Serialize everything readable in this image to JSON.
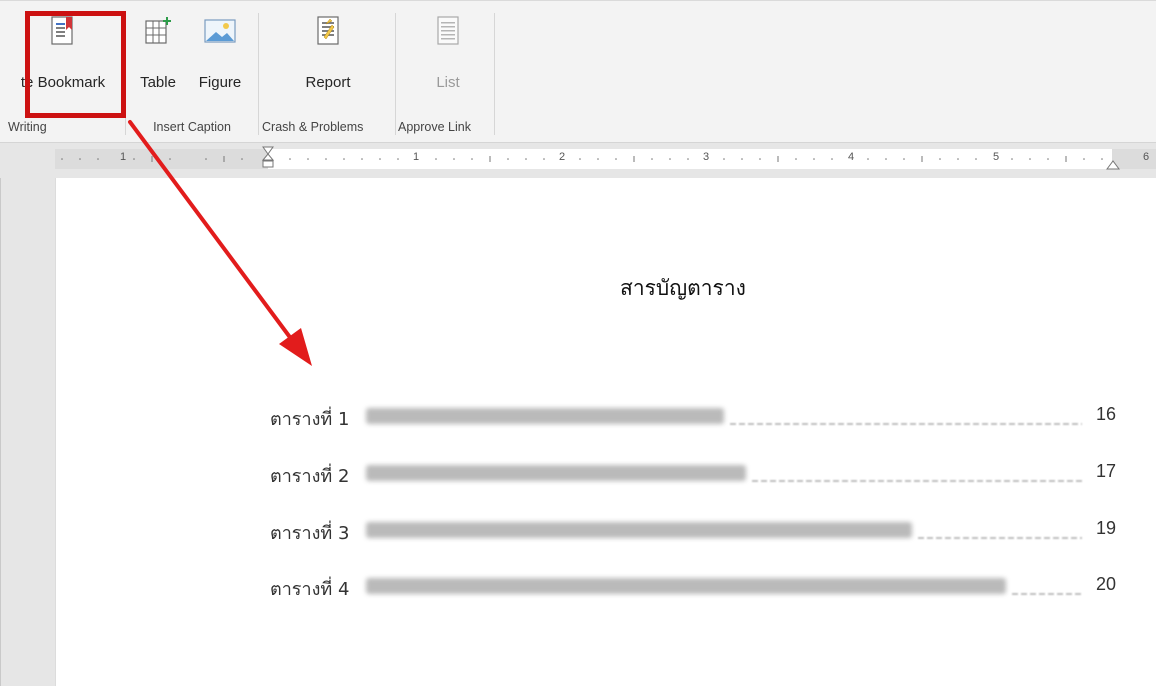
{
  "ribbon": {
    "groups": [
      {
        "label": "Writing",
        "buttons": [
          {
            "label": "te Bookmark",
            "icon": "bookmark-icon"
          }
        ]
      },
      {
        "label": "Insert Caption",
        "buttons": [
          {
            "label": "Table",
            "icon": "table-caption-icon"
          },
          {
            "label": "Figure",
            "icon": "figure-caption-icon"
          }
        ]
      },
      {
        "label": "Crash & Problems",
        "buttons": [
          {
            "label": "Report",
            "icon": "report-icon"
          }
        ]
      },
      {
        "label": "Approve Link",
        "buttons": [
          {
            "label": "List",
            "icon": "list-icon",
            "disabled": true
          }
        ]
      }
    ]
  },
  "ruler": {
    "ticks": [
      "1",
      "1",
      "2",
      "3",
      "4",
      "5",
      "6"
    ]
  },
  "document": {
    "title": "สารบัญตาราง",
    "toc": [
      {
        "label": "ตารางที่ 1",
        "page": "16"
      },
      {
        "label": "ตารางที่ 2",
        "page": "17"
      },
      {
        "label": "ตารางที่ 3",
        "page": "19"
      },
      {
        "label": "ตารางที่ 4",
        "page": "20"
      }
    ]
  },
  "colors": {
    "highlight": "#cc1111",
    "arrow": "#e21c1c",
    "ribbon_bg": "#f3f3f3"
  }
}
